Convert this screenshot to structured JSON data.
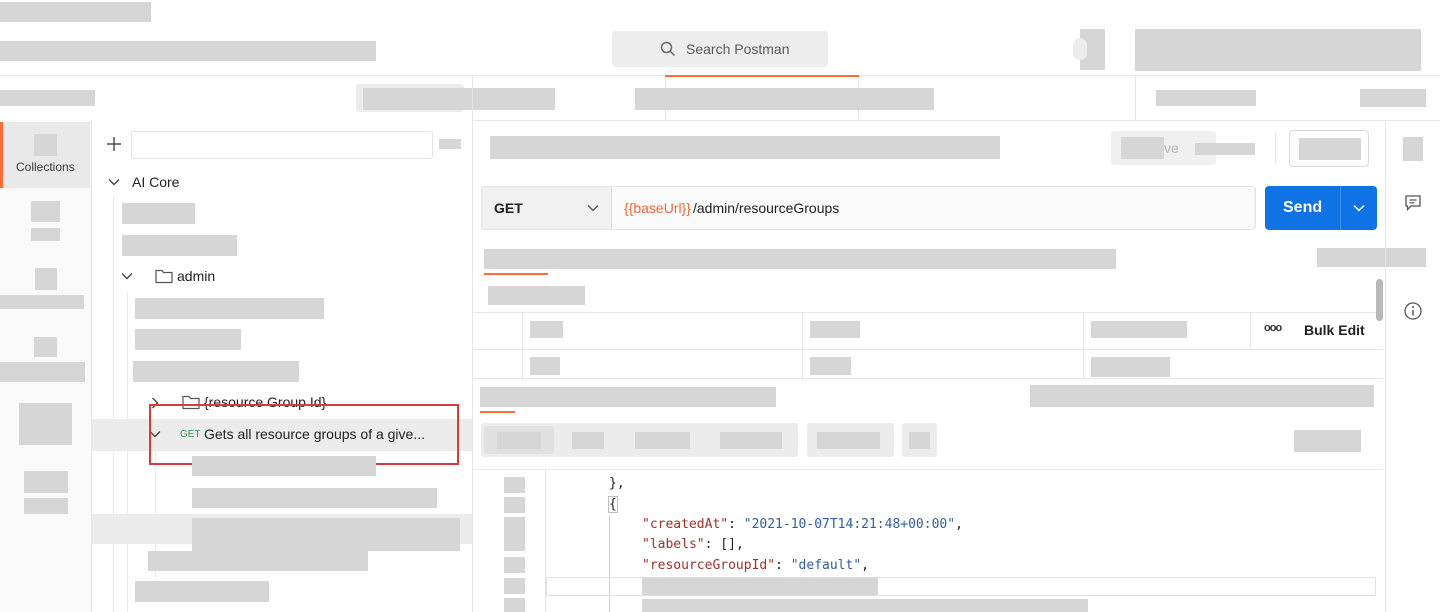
{
  "header": {
    "search_placeholder": "Search Postman"
  },
  "sidebar": {
    "rail_item_collections": "Collections",
    "collection_name": "AI Core",
    "folder_admin": "admin",
    "folder_resource": "{resource Group Id}",
    "request_method": "GET",
    "request_name": "Gets all resource groups of a give..."
  },
  "request": {
    "method": "GET",
    "url_var": "{{baseUrl}}",
    "url_path": "/admin/resourceGroups",
    "send_label": "Send",
    "save_label": "ve",
    "bulk_edit_label": "Bulk Edit",
    "more_label": "ooo"
  },
  "response": {
    "line1": "},",
    "line2": "{",
    "created_key": "\"createdAt\"",
    "created_val": "\"2021-10-07T14:21:48+00:00\"",
    "labels_key": "\"labels\"",
    "labels_val": "[]",
    "rg_key": "\"resourceGroupId\"",
    "rg_val": "\"default\""
  },
  "colors": {
    "accent": "#ff6c37",
    "send": "#0f73e6",
    "highlight_box": "#d93a3a",
    "method_get_small": "#2a9d4a"
  }
}
